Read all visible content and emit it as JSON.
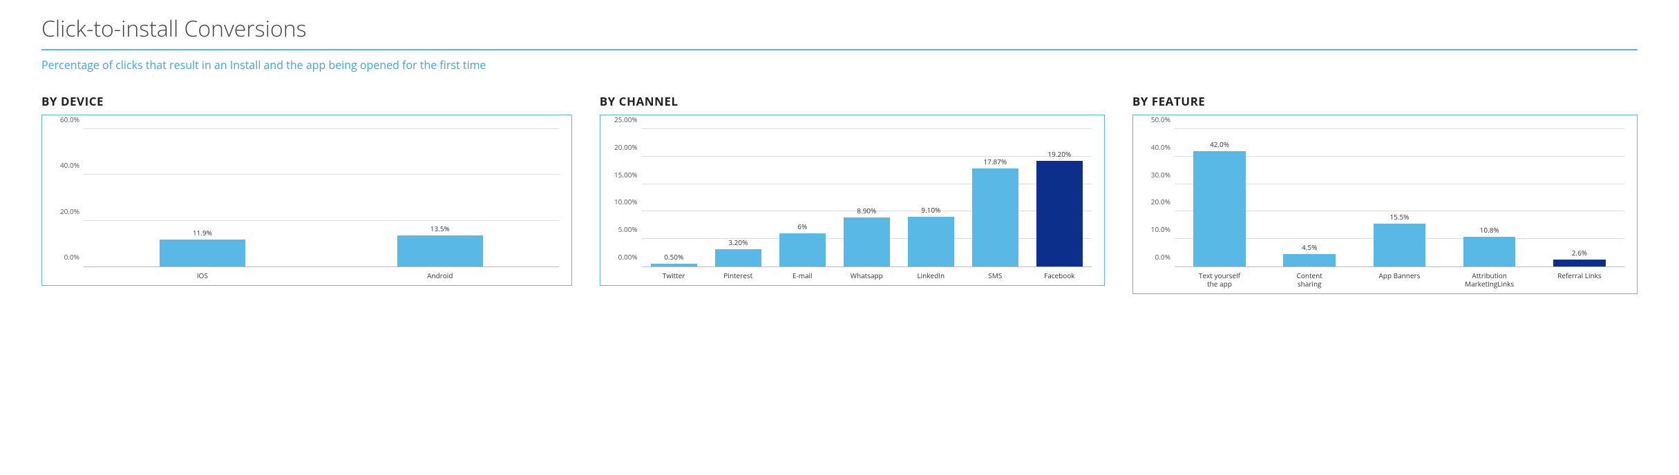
{
  "page": {
    "title": "Click-to-install Conversions",
    "subtitle": "Percentage of clicks that result in an Install and the app being opened for the first time"
  },
  "charts": {
    "by_device": {
      "title": "BY DEVICE"
    },
    "by_channel": {
      "title": "BY CHANNEL"
    },
    "by_feature": {
      "title": "BY FEATURE"
    }
  },
  "chart_data": [
    {
      "id": "by_device",
      "type": "bar",
      "title": "BY DEVICE",
      "categories": [
        "iOS",
        "Android"
      ],
      "values": [
        11.9,
        13.5
      ],
      "value_labels": [
        "11.9%",
        "13.5%"
      ],
      "highlight_index": null,
      "ylim": [
        0,
        60
      ],
      "yticks": [
        0,
        20,
        40,
        60
      ],
      "ytick_labels": [
        "0.0%",
        "20.0%",
        "40.0%",
        "60.0%"
      ],
      "bar_width_pct": 36,
      "ylabel": "",
      "xlabel": ""
    },
    {
      "id": "by_channel",
      "type": "bar",
      "title": "BY CHANNEL",
      "categories": [
        "Twitter",
        "Pinterest",
        "E-mail",
        "Whatsapp",
        "LinkedIn",
        "SMS",
        "Facebook"
      ],
      "values": [
        0.5,
        3.2,
        6.0,
        8.9,
        9.1,
        17.87,
        19.2
      ],
      "value_labels": [
        "0.50%",
        "3.20%",
        "6%",
        "8.90%",
        "9.10%",
        "17.87%",
        "19.20%"
      ],
      "highlight_index": 6,
      "ylim": [
        0,
        25
      ],
      "yticks": [
        0,
        5,
        10,
        15,
        20,
        25
      ],
      "ytick_labels": [
        "0.00%",
        "5.00%",
        "10.00%",
        "15.00%",
        "20.00%",
        "25.00%"
      ],
      "bar_width_pct": 72,
      "ylabel": "",
      "xlabel": ""
    },
    {
      "id": "by_feature",
      "type": "bar",
      "title": "BY FEATURE",
      "categories": [
        "Text yourself the app",
        "Content sharing",
        "App Banners",
        "Attribution MarketingLinks",
        "Referral Links"
      ],
      "values": [
        42.0,
        4.5,
        15.5,
        10.8,
        2.6
      ],
      "value_labels": [
        "42.0%",
        "4.5%",
        "15.5%",
        "10.8%",
        "2.6%"
      ],
      "highlight_index": 4,
      "ylim": [
        0,
        50
      ],
      "yticks": [
        0,
        10,
        20,
        30,
        40,
        50
      ],
      "ytick_labels": [
        "0.0%",
        "10.0%",
        "20.0%",
        "30.0%",
        "40.0%",
        "50.0%"
      ],
      "bar_width_pct": 58,
      "ylabel": "",
      "xlabel": ""
    }
  ],
  "colors": {
    "bar": "#59b8e6",
    "bar_highlight": "#0b2f8a",
    "accent": "#59b8e6",
    "subtitle": "#3aa7db"
  }
}
